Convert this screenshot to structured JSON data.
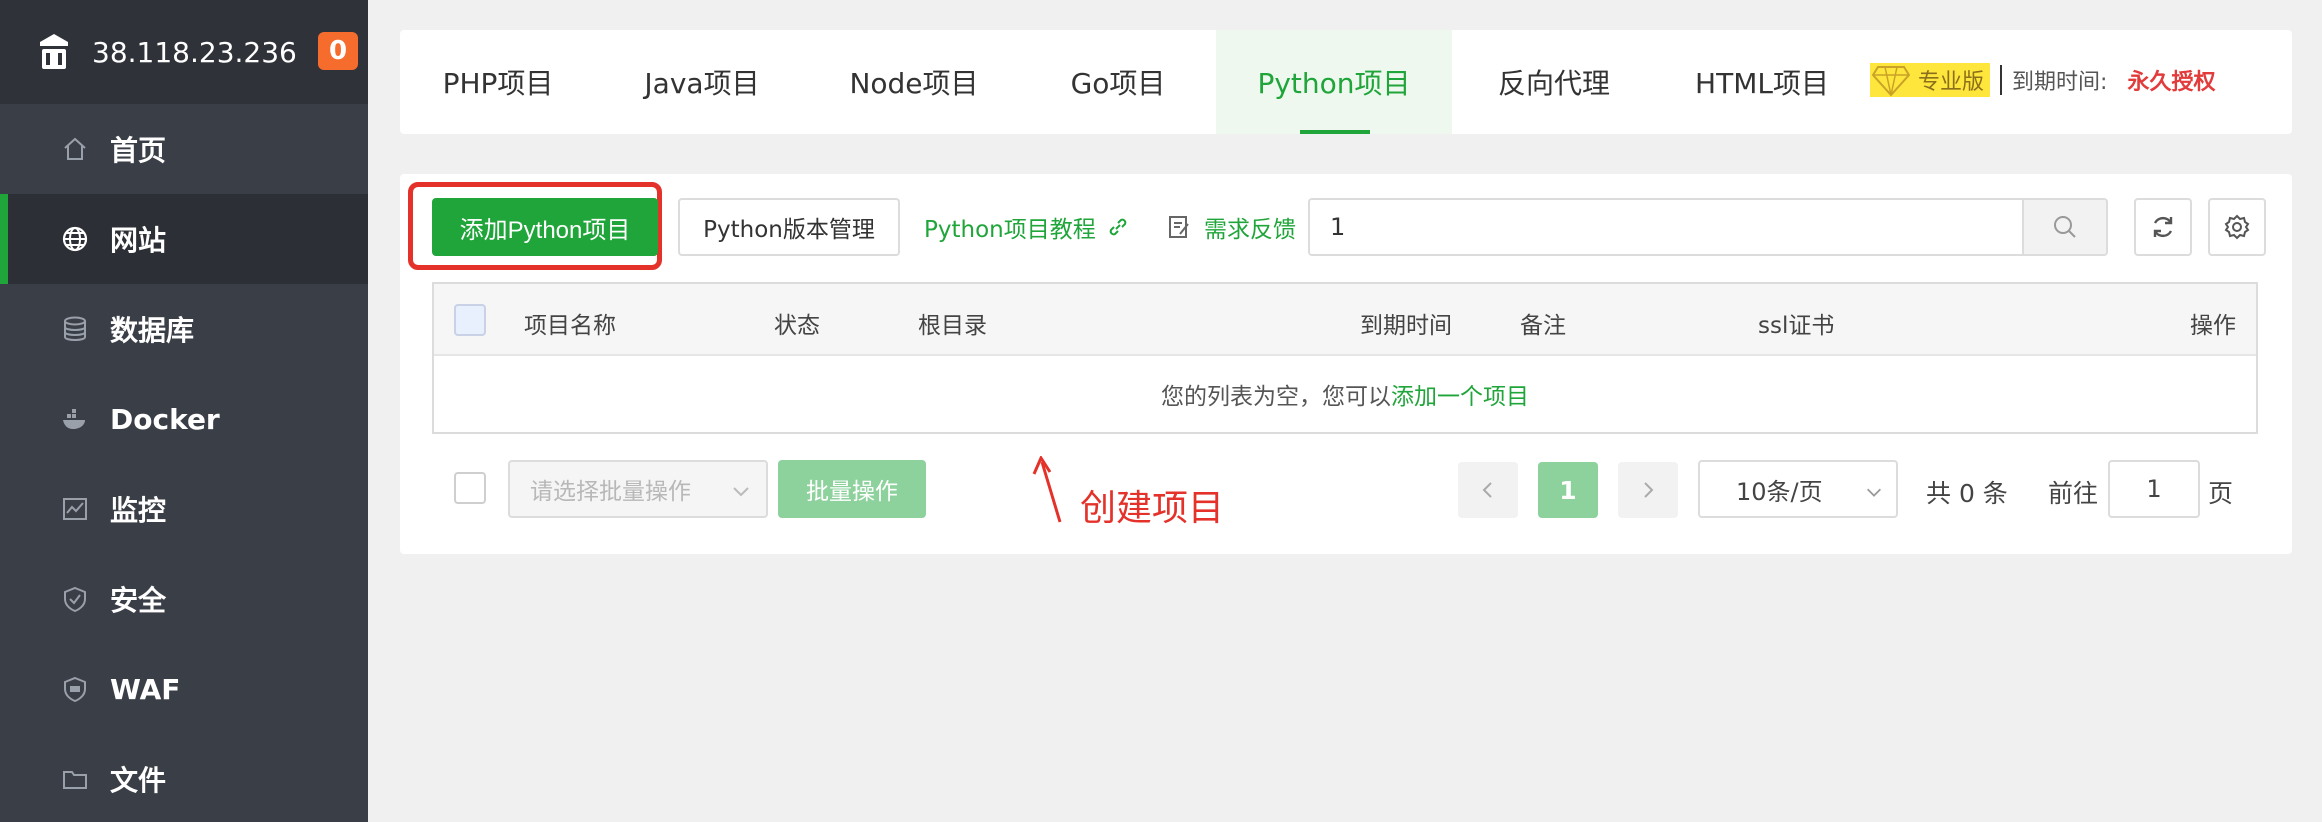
{
  "header": {
    "server_ip": "38.118.23.236",
    "notification_count": "0"
  },
  "sidebar": {
    "items": [
      {
        "label": "首页",
        "icon": "home-icon"
      },
      {
        "label": "网站",
        "icon": "globe-icon",
        "active": true
      },
      {
        "label": "数据库",
        "icon": "database-icon"
      },
      {
        "label": "Docker",
        "icon": "docker-icon"
      },
      {
        "label": "监控",
        "icon": "monitor-icon"
      },
      {
        "label": "安全",
        "icon": "shield-icon"
      },
      {
        "label": "WAF",
        "icon": "waf-shield-icon"
      },
      {
        "label": "文件",
        "icon": "folder-icon"
      }
    ]
  },
  "tabs": [
    {
      "label": "PHP项目"
    },
    {
      "label": "Java项目"
    },
    {
      "label": "Node项目"
    },
    {
      "label": "Go项目"
    },
    {
      "label": "Python项目",
      "active": true
    },
    {
      "label": "反向代理"
    },
    {
      "label": "HTML项目"
    }
  ],
  "license": {
    "edition": "专业版",
    "expire_label": "到期时间:",
    "expire_value": "永久授权"
  },
  "toolbar": {
    "add_button": "添加Python项目",
    "version_button": "Python版本管理",
    "tutorial_link": "Python项目教程",
    "feedback_link": "需求反馈",
    "search_value": "1"
  },
  "table": {
    "columns": [
      "项目名称",
      "状态",
      "根目录",
      "到期时间",
      "备注",
      "ssl证书",
      "操作"
    ],
    "empty_text": "您的列表为空，您可以",
    "empty_link": "添加一个项目"
  },
  "annotation": {
    "text": "创建项目"
  },
  "footer": {
    "batch_placeholder": "请选择批量操作",
    "batch_button": "批量操作",
    "current_page": "1",
    "page_size": "10条/页",
    "total": "共 0 条",
    "goto_label": "前往",
    "goto_value": "1",
    "page_label": "页"
  },
  "colors": {
    "accent": "#20a53a",
    "sidebar": "#3a3e47",
    "alert": "#e4322b",
    "badge": "#f56c2d"
  }
}
